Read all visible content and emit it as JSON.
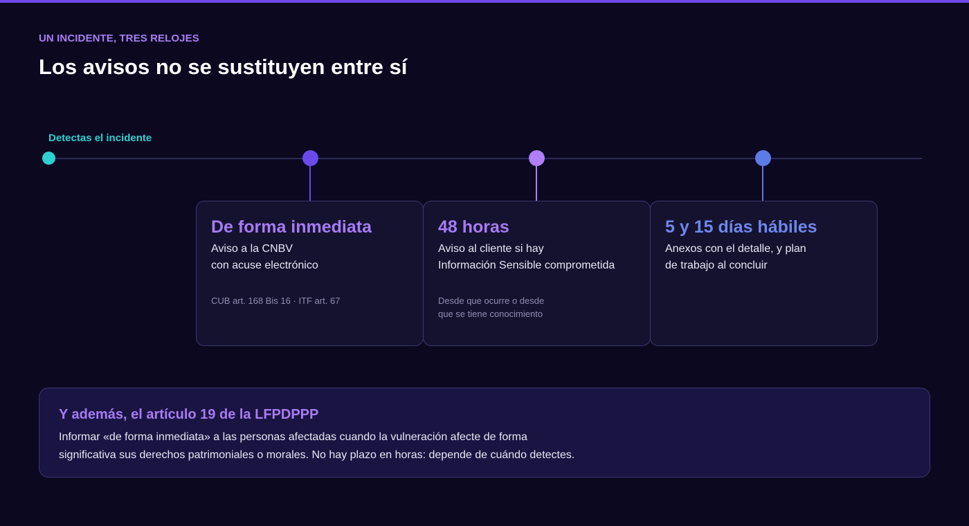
{
  "header": {
    "eyebrow": "UN INCIDENTE, TRES RELOJES",
    "title": "Los avisos no se sustituyen entre sí"
  },
  "timeline": {
    "start_label": "Detectas el incidente",
    "colors": {
      "start": "#2fd0d0",
      "milestone_1": "#6b4aeb",
      "milestone_2": "#b07ef7",
      "milestone_3": "#5d7be6"
    },
    "milestones": [
      {
        "title": "De forma inmediata",
        "desc_line1": "Aviso a la CNBV",
        "desc_line2": "con acuse electrónico",
        "note_line1": "CUB art. 168 Bis 16 · ITF art. 67",
        "note_line2": ""
      },
      {
        "title": "48 horas",
        "desc_line1": "Aviso al cliente si hay",
        "desc_line2": "Información Sensible comprometida",
        "note_line1": "Desde que ocurre o desde",
        "note_line2": "que se tiene conocimiento"
      },
      {
        "title": "5 y 15 días hábiles",
        "desc_line1": "Anexos con el detalle, y plan",
        "desc_line2": "de trabajo al concluir",
        "note_line1": "",
        "note_line2": ""
      }
    ]
  },
  "callout": {
    "title": "Y además, el artículo 19 de la LFPDPPP",
    "text_line1": "Informar «de forma inmediata» a las personas afectadas cuando la vulneración afecte de forma",
    "text_line2": "significativa sus derechos patrimoniales o morales. No hay plazo en horas: depende de cuándo detectes."
  }
}
